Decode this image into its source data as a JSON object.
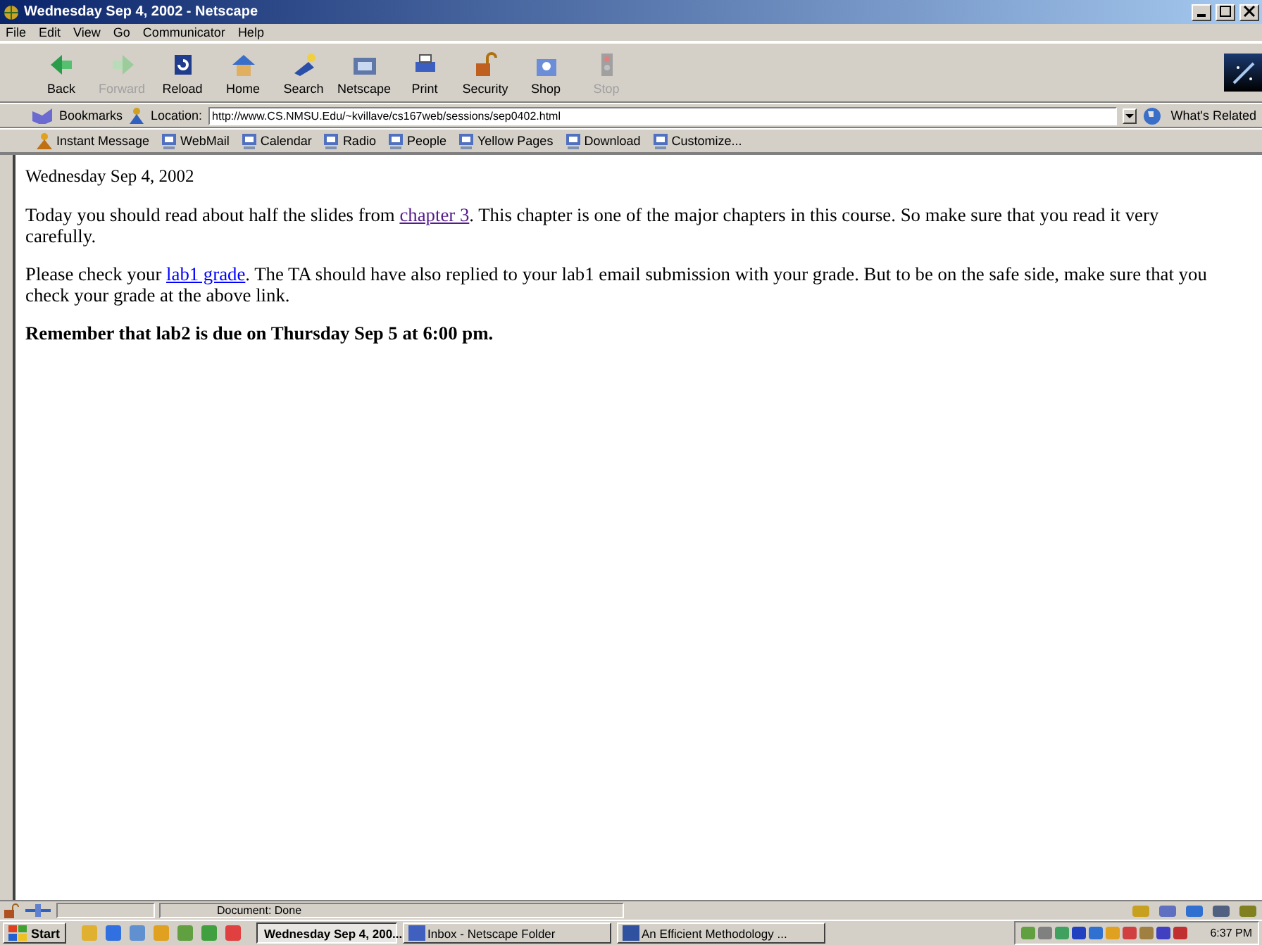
{
  "window": {
    "title": "Wednesday Sep 4, 2002 - Netscape"
  },
  "menu": [
    "File",
    "Edit",
    "View",
    "Go",
    "Communicator",
    "Help"
  ],
  "toolbar": [
    {
      "label": "Back",
      "disabled": false
    },
    {
      "label": "Forward",
      "disabled": true
    },
    {
      "label": "Reload",
      "disabled": false
    },
    {
      "label": "Home",
      "disabled": false
    },
    {
      "label": "Search",
      "disabled": false
    },
    {
      "label": "Netscape",
      "disabled": false
    },
    {
      "label": "Print",
      "disabled": false
    },
    {
      "label": "Security",
      "disabled": false
    },
    {
      "label": "Shop",
      "disabled": false
    },
    {
      "label": "Stop",
      "disabled": true
    }
  ],
  "location_bar": {
    "bookmarks": "Bookmarks",
    "location_label": "Location:",
    "url": "http://www.CS.NMSU.Edu/~kvillave/cs167web/sessions/sep0402.html",
    "whats_related": "What's Related"
  },
  "personal_toolbar": [
    "Instant Message",
    "WebMail",
    "Calendar",
    "Radio",
    "People",
    "Yellow Pages",
    "Download",
    "Customize..."
  ],
  "page": {
    "heading": "Wednesday Sep 4, 2002",
    "paragraphs": [
      {
        "bold": false,
        "segments": [
          {
            "kind": "text",
            "text": "Today you should read about half the slides from "
          },
          {
            "kind": "link",
            "text": "chapter 3",
            "visited": true
          },
          {
            "kind": "text",
            "text": ". This chapter is one of the major chapters in this course. So make sure that you read it very carefully."
          }
        ]
      },
      {
        "bold": false,
        "segments": [
          {
            "kind": "text",
            "text": "Please check your "
          },
          {
            "kind": "link",
            "text": "lab1 grade",
            "visited": false
          },
          {
            "kind": "text",
            "text": ". The TA should have also replied to your lab1 email submission with your grade. But to be on the safe side, make sure that you check your grade at the above link."
          }
        ]
      },
      {
        "bold": true,
        "segments": [
          {
            "kind": "text",
            "text": "Remember that lab2 is due on Thursday Sep 5 at 6:00 pm."
          }
        ]
      }
    ]
  },
  "status_bar": {
    "text": "Document: Done"
  },
  "taskbar": {
    "start": "Start",
    "tasks": [
      {
        "label": "Wednesday Sep 4, 200...",
        "selected": true
      },
      {
        "label": "Inbox - Netscape Folder",
        "selected": false
      },
      {
        "label": "An Efficient Methodology ...",
        "selected": false
      }
    ],
    "clock": "6:37 PM"
  }
}
